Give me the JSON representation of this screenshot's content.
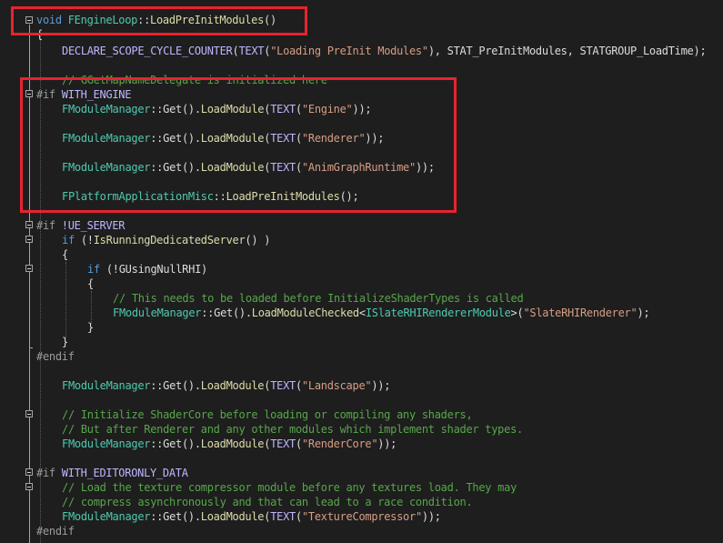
{
  "code": {
    "signature": {
      "kw": "void",
      "cls": "FEngineLoop",
      "sep": "::",
      "fn": "LoadPreInitModules",
      "rest": "()"
    },
    "brace_open": "{",
    "cycle_counter": {
      "macro": "DECLARE_SCOPE_CYCLE_COUNTER",
      "p1": "(",
      "text_macro": "TEXT",
      "p2": "(",
      "str": "\"Loading PreInit Modules\"",
      "rest": "), STAT_PreInitModules, STATGROUP_LoadTime);"
    },
    "comment_mapname": "// GGetMapNameDelegate is initialized here",
    "if_with_engine": {
      "directive": "#if",
      "symbol": "WITH_ENGINE"
    },
    "module_class": "FModuleManager",
    "get_call": "::Get().",
    "load_module": "LoadModule",
    "text_open": "(",
    "text_macro": "TEXT",
    "close2": "));",
    "modules_engine": [
      "\"Engine\"",
      "\"Renderer\"",
      "\"AnimGraphRuntime\""
    ],
    "platform_line": {
      "cls": "FPlatformApplicationMisc",
      "sep": "::",
      "fn": "LoadPreInitModules",
      "rest": "();"
    },
    "if_ue_server": {
      "directive": "#if",
      "symbol": "!UE_SERVER"
    },
    "dedicated_line": {
      "kw": "if",
      "p": " (!",
      "fn": "IsRunningDedicatedServer",
      "rest": "() )"
    },
    "brace_open2": "{",
    "null_rhi_line": {
      "kw": "if",
      "p": " (!",
      "var": "GUsingNullRHI",
      "rest": ")"
    },
    "brace_open3": "{",
    "comment_shader_types": "// This needs to be loaded before InitializeShaderTypes is called",
    "checked_line": {
      "cls": "FModuleManager",
      "get": "::Get().",
      "fn": "LoadModuleChecked",
      "lt": "<",
      "tmpl": "ISlateRHIRendererModule",
      "gt": ">(",
      "str": "\"SlateRHIRenderer\"",
      "rest": ");"
    },
    "brace_close3": "}",
    "brace_close2": "}",
    "endif1": "#endif",
    "landscape_str": "\"Landscape\"",
    "comment_shadercore_1": "// Initialize ShaderCore before loading or compiling any shaders,",
    "comment_shadercore_2": "// But after Renderer and any other modules which implement shader types.",
    "rendercore_str": "\"RenderCore\"",
    "if_editoronly": {
      "directive": "#if",
      "symbol": "WITH_EDITORONLY_DATA"
    },
    "comment_texture_1": "// Load the texture compressor module before any textures load. They may",
    "comment_texture_2": "// compress asynchronously and that can lead to a race condition.",
    "texture_str": "\"TextureCompressor\"",
    "endif2": "#endif"
  }
}
